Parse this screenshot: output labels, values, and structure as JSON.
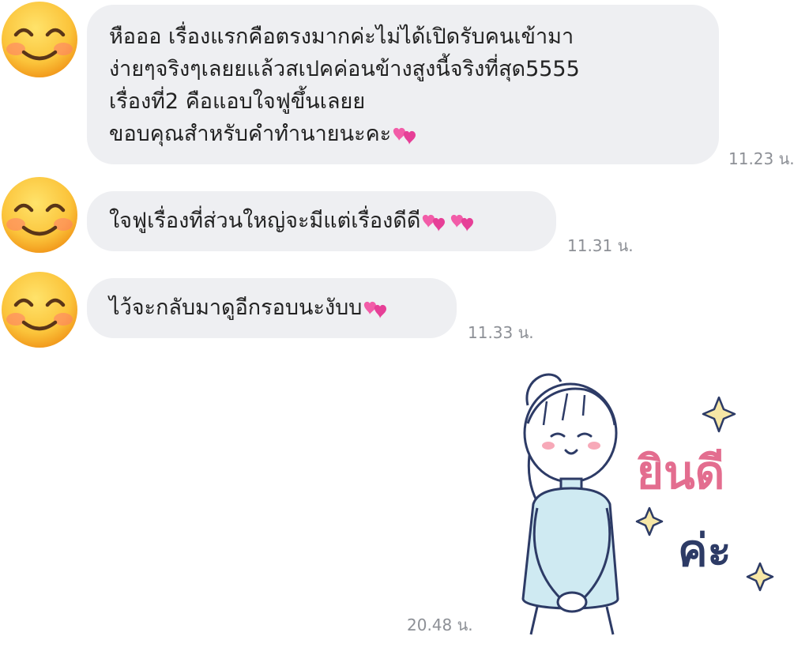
{
  "messages": [
    {
      "lines": [
        "หือออ เรื่องแรกคือตรงมากค่ะไม่ได้เปิดรับคนเข้ามา",
        "ง่ายๆจริงๆเลยยแล้วสเปคค่อนข้างสูงนี้จริงที่สุด5555",
        "เรื่องที่2 คือแอบใจฟูขึ้นเลยย",
        "ขอบคุณสำหรับคำทำนายนะคะ"
      ],
      "time": "11.23 น.",
      "emoji": "revolving-hearts-icon"
    },
    {
      "lines": [
        "ใจฟูเรื่องที่ส่วนใหญ่จะมีแต่เรื่องดีดี"
      ],
      "time": "11.31 น.",
      "emoji": "revolving-hearts-icon"
    },
    {
      "lines": [
        "ไว้จะกลับมาดูอีกรอบนะงับบ"
      ],
      "time": "11.33 น.",
      "emoji": "revolving-hearts-icon"
    }
  ],
  "sticker": {
    "time": "20.48 น.",
    "text_line1": "ยินดี",
    "text_line2": "ค่ะ",
    "pink": "#e36d8f",
    "navy": "#2d3b66"
  },
  "colors": {
    "bubble": "#eeeff2",
    "timestamp": "#8d9096"
  }
}
